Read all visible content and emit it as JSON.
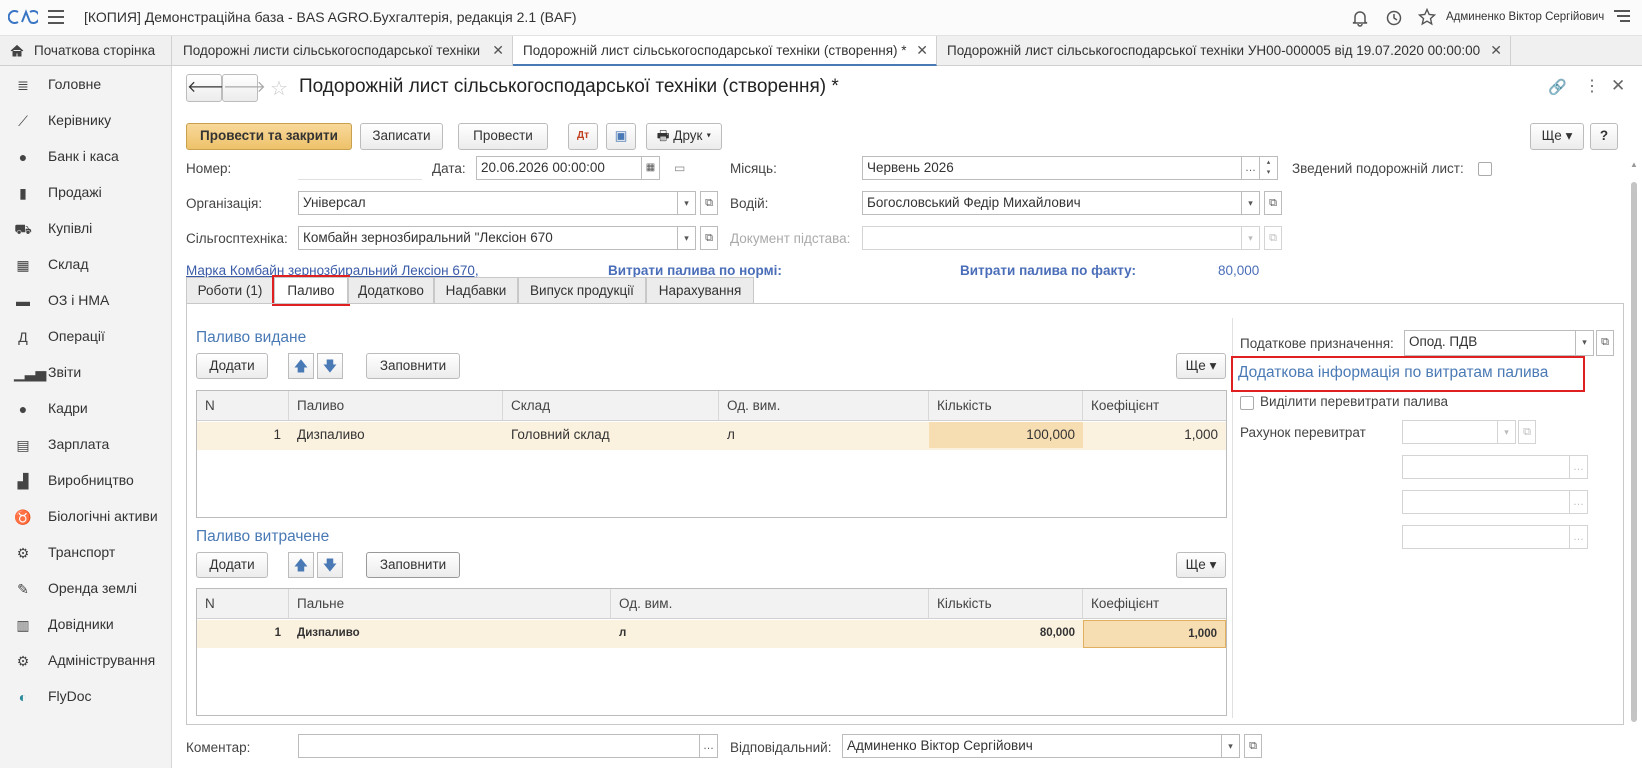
{
  "title_bar": {
    "title": "[КОПИЯ] Демонстраційна база - BAS AGRO.Бухгалтерія, редакція 2.1  (BAF)",
    "user": "Админенко Віктор Сергійович"
  },
  "tabs": {
    "home": "Початкова сторінка",
    "t1": "Подорожні листи сільськогосподарської техніки",
    "t2": "Подорожній лист сільськогосподарської техніки (створення) *",
    "t3": "Подорожній лист сільськогосподарської техніки УН00-000005 від 19.07.2020 00:00:00"
  },
  "sidebar": {
    "items": [
      "Головне",
      "Керівнику",
      "Банк і каса",
      "Продажі",
      "Купівлі",
      "Склад",
      "ОЗ і НМА",
      "Операції",
      "Звіти",
      "Кадри",
      "Зарплата",
      "Виробництво",
      "Біологічні активи",
      "Транспорт",
      "Оренда землі",
      "Довідники",
      "Адміністрування",
      "FlyDoc"
    ]
  },
  "doc": {
    "title": "Подорожній лист сільськогосподарської техніки (створення) *",
    "btn_post_close": "Провести та закрити",
    "btn_save": "Записати",
    "btn_post": "Провести",
    "btn_print": "Друк",
    "btn_more": "Ще",
    "btn_help": "?"
  },
  "form": {
    "number_label": "Номер:",
    "number_value": "",
    "date_label": "Дата:",
    "date_value": "20.06.2026 00:00:00",
    "month_label": "Місяць:",
    "month_value": "Червень 2026",
    "summary_label": "Зведений подорожній лист:",
    "org_label": "Організація:",
    "org_value": "Універсал",
    "driver_label": "Водій:",
    "driver_value": "Богословський Федір Михайлович",
    "machine_label": "Сільгосптехніка:",
    "machine_value": "Комбайн зернозбиральний \"Лексіон 670",
    "basis_label": "Документ підстава:",
    "basis_value": "",
    "brand_link": "Марка Комбайн зернозбиральний Лексіон 670,",
    "norm_label": "Витрати палива по нормі:",
    "fact_label": "Витрати палива по факту:",
    "fact_value": "80,000"
  },
  "form_tabs": [
    "Роботи (1)",
    "Паливо",
    "Додатково",
    "Надбавки",
    "Випуск продукції",
    "Нарахування"
  ],
  "issued": {
    "title": "Паливо видане",
    "add": "Додати",
    "fill": "Заповнити",
    "more": "Ще",
    "columns": [
      "N",
      "Паливо",
      "Склад",
      "Од. вим.",
      "Кількість",
      "Коефіцієнт"
    ],
    "rows": [
      [
        "1",
        "Дизпаливо",
        "Головний склад",
        "л",
        "100,000",
        "1,000"
      ]
    ]
  },
  "consumed": {
    "title": "Паливо витрачене",
    "add": "Додати",
    "fill": "Заповнити",
    "more": "Ще",
    "columns": [
      "N",
      "Пальне",
      "Од. вим.",
      "Кількість",
      "Коефіцієнт"
    ],
    "rows": [
      [
        "1",
        "Дизпаливо",
        "л",
        "80,000",
        "1,000"
      ]
    ]
  },
  "right_panel": {
    "tax_label": "Податкове призначення:",
    "tax_value": "Опод. ПДВ",
    "info_title": "Додаткова інформація по витратам палива",
    "overuse_label": "Виділити перевитрати палива",
    "account_label": "Рахунок перевитрат"
  },
  "footer": {
    "comment_label": "Коментар:",
    "comment_value": "",
    "responsible_label": "Відповідальний:",
    "responsible_value": "Админенко Віктор Сергійович"
  }
}
